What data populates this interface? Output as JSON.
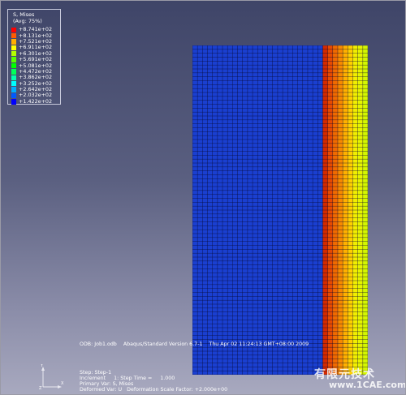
{
  "legend": {
    "title": "S, Mises",
    "subtitle": "(Avg: 75%)",
    "entries": [
      {
        "value": "+8.741e+02",
        "color": "#ff0000"
      },
      {
        "value": "+8.131e+02",
        "color": "#ff5a00"
      },
      {
        "value": "+7.521e+02",
        "color": "#ffae00"
      },
      {
        "value": "+6.911e+02",
        "color": "#ffff00"
      },
      {
        "value": "+6.301e+02",
        "color": "#b4ff00"
      },
      {
        "value": "+5.691e+02",
        "color": "#5aff00"
      },
      {
        "value": "+5.081e+02",
        "color": "#00ff00"
      },
      {
        "value": "+4.472e+02",
        "color": "#00ff5a"
      },
      {
        "value": "+3.862e+02",
        "color": "#00ffae"
      },
      {
        "value": "+3.252e+02",
        "color": "#00ffff"
      },
      {
        "value": "+2.642e+02",
        "color": "#00aeff"
      },
      {
        "value": "+2.032e+02",
        "color": "#005aff"
      },
      {
        "value": "+1.422e+02",
        "color": "#0000ff"
      }
    ]
  },
  "model": {
    "mesh_columns": 35,
    "mesh_rows": 84,
    "base_color": "#1a3fd0",
    "gradient_columns": [
      "#d42a00",
      "#e84a00",
      "#f06a00",
      "#f88a00",
      "#ffb000",
      "#ffd000",
      "#f2ee00",
      "#e6f400",
      "#d4f600"
    ]
  },
  "info": {
    "odb_line": "ODB: Job1.odb    Abaqus/Standard Version 6.7-1    Thu Apr 02 11:24:13 GMT+08:00 2009",
    "step_line": "Step: Step-1",
    "increment_line": "Increment     1: Step Time =     1.000",
    "primary_var_line": "Primary Var: S, Mises",
    "deformed_var_line": "Deformed Var: U   Deformation Scale Factor: +2.000e+00"
  },
  "watermark": {
    "text": "有限元技术",
    "subtext": "www.1CAE.com"
  }
}
